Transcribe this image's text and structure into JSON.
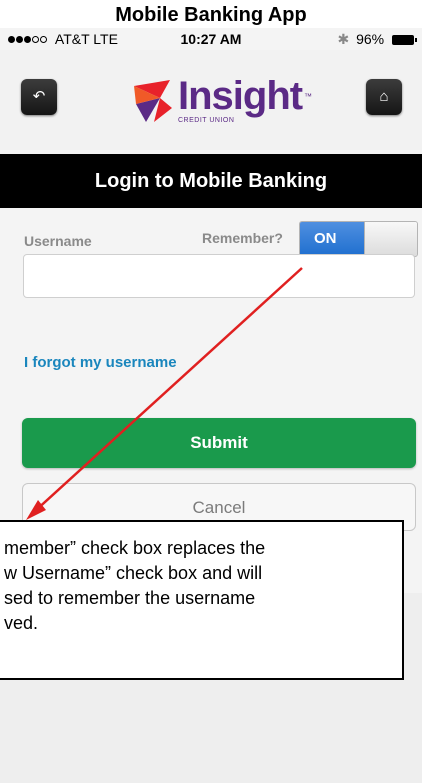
{
  "doc_title": "Mobile Banking App",
  "status_bar": {
    "carrier": "AT&T",
    "network": "LTE",
    "time": "10:27 AM",
    "battery": "96%"
  },
  "header": {
    "back_icon": "back-icon",
    "home_icon": "home-icon",
    "logo_word": "Insight",
    "logo_subtext": "CREDIT UNION"
  },
  "login": {
    "title": "Login to Mobile Banking",
    "username_label": "Username",
    "remember_label": "Remember?",
    "toggle_state": "ON",
    "username_value": "",
    "forgot_link": "I forgot my username",
    "submit_label": "Submit",
    "cancel_label": "Cancel"
  },
  "annotation": {
    "lines": [
      "member” check box replaces the",
      "w Username” check box and will",
      "sed to remember the username",
      "ved."
    ]
  },
  "colors": {
    "submit": "#1a9a4c",
    "toggle_on": "#1f6fcf",
    "link": "#1a86bd",
    "brand": "#5b2a86",
    "arrow": "#e02020"
  }
}
